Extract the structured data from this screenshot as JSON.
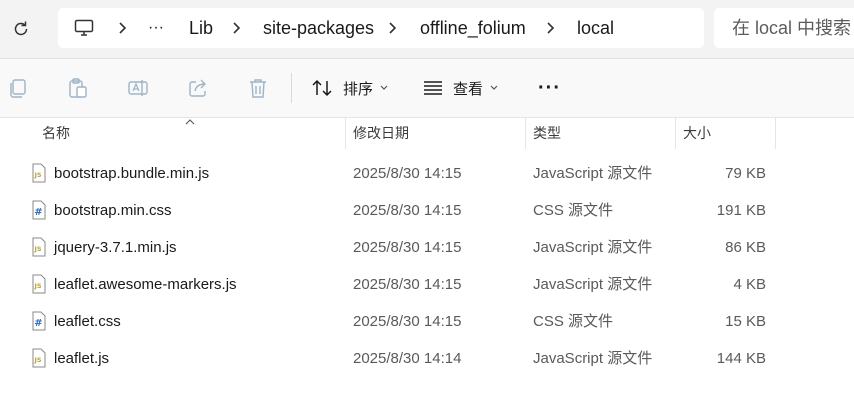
{
  "address_bar": {
    "refresh_icon": "refresh-icon",
    "computer_icon": "computer-icon",
    "overflow": "···",
    "crumbs": [
      "Lib",
      "site-packages",
      "offline_folium",
      "local"
    ],
    "search_placeholder": "在 local 中搜索"
  },
  "toolbar": {
    "actions": [
      "copy-icon",
      "paste-icon",
      "rename-icon",
      "share-icon",
      "delete-icon"
    ],
    "sort_label": "排序",
    "view_label": "查看",
    "more_label": "···"
  },
  "columns": {
    "name": "名称",
    "date": "修改日期",
    "type": "类型",
    "size": "大小"
  },
  "files": [
    {
      "name": "bootstrap.bundle.min.js",
      "date": "2025/8/30 14:15",
      "type": "JavaScript 源文件",
      "size": "79 KB",
      "icon": "js-file-icon"
    },
    {
      "name": "bootstrap.min.css",
      "date": "2025/8/30 14:15",
      "type": "CSS 源文件",
      "size": "191 KB",
      "icon": "css-file-icon"
    },
    {
      "name": "jquery-3.7.1.min.js",
      "date": "2025/8/30 14:15",
      "type": "JavaScript 源文件",
      "size": "86 KB",
      "icon": "js-file-icon"
    },
    {
      "name": "leaflet.awesome-markers.js",
      "date": "2025/8/30 14:15",
      "type": "JavaScript 源文件",
      "size": "4 KB",
      "icon": "js-file-icon"
    },
    {
      "name": "leaflet.css",
      "date": "2025/8/30 14:15",
      "type": "CSS 源文件",
      "size": "15 KB",
      "icon": "css-file-icon"
    },
    {
      "name": "leaflet.js",
      "date": "2025/8/30 14:14",
      "type": "JavaScript 源文件",
      "size": "144 KB",
      "icon": "js-file-icon"
    }
  ],
  "colors": {
    "js_icon": "#b8a23a",
    "css_icon": "#2f6fb6",
    "disabled_icon": "#9fb4c8"
  }
}
